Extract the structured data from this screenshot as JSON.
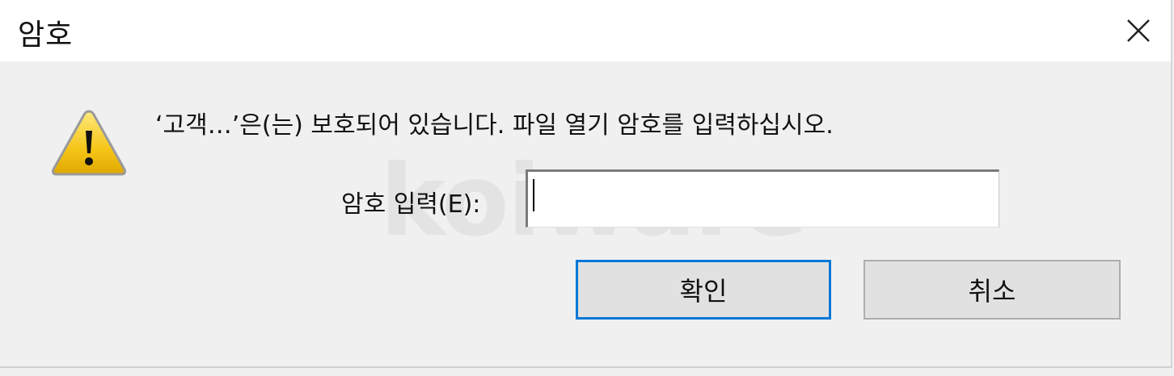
{
  "window": {
    "title": "암호",
    "close_icon": "close-icon"
  },
  "message": {
    "text": "‘고객…’은(는) 보호되어 있습니다. 파일 열기 암호를 입력하십시오.",
    "icon": "warning-icon"
  },
  "password": {
    "label": "암호 입력(E):",
    "value": ""
  },
  "buttons": {
    "ok_label": "확인",
    "cancel_label": "취소"
  },
  "watermark": "koiware",
  "colors": {
    "accent": "#0078d7",
    "dialog_bg": "#f0f0f0",
    "warning_yellow": "#f5c518"
  }
}
